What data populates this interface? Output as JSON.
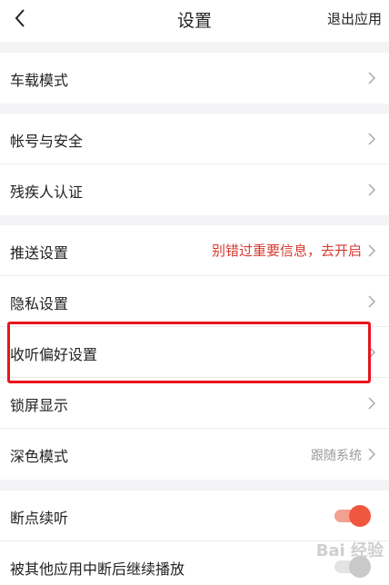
{
  "header": {
    "title": "设置",
    "exit_label": "退出应用"
  },
  "groups": [
    {
      "items": [
        {
          "label": "车载模式"
        }
      ]
    },
    {
      "items": [
        {
          "label": "帐号与安全"
        },
        {
          "label": "残疾人认证"
        }
      ]
    },
    {
      "items": [
        {
          "label": "推送设置",
          "value": "别错过重要信息，去开启"
        },
        {
          "label": "隐私设置"
        },
        {
          "label": "收听偏好设置"
        },
        {
          "label": "锁屏显示"
        },
        {
          "label": "深色模式",
          "value": "跟随系统"
        }
      ]
    },
    {
      "items": [
        {
          "label": "断点续听",
          "toggle": "on"
        },
        {
          "label": "被其他应用中断后继续播放",
          "toggle": "off"
        }
      ]
    }
  ],
  "colors": {
    "accent": "#f0573f",
    "highlight": "#e8151c",
    "promo_text": "#d43a30"
  },
  "watermark": {
    "text": "Bai 经验"
  }
}
